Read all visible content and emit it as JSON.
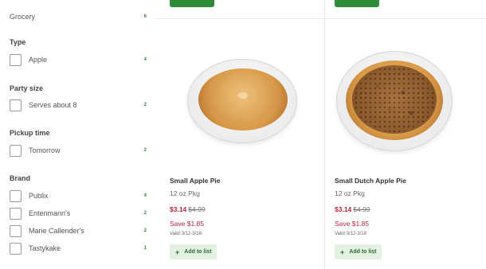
{
  "sidebar": {
    "category": {
      "label": "Grocery",
      "count": "6"
    },
    "sections": [
      {
        "title": "Type",
        "items": [
          {
            "label": "Apple",
            "count": "4"
          }
        ]
      },
      {
        "title": "Party size",
        "items": [
          {
            "label": "Serves about 8",
            "count": "2"
          }
        ]
      },
      {
        "title": "Pickup time",
        "items": [
          {
            "label": "Tomorrow",
            "count": "2"
          }
        ]
      },
      {
        "title": "Brand",
        "items": [
          {
            "label": "Publix",
            "count": "4"
          },
          {
            "label": "Entenmann's",
            "count": "2"
          },
          {
            "label": "Marie Callender's",
            "count": "2"
          },
          {
            "label": "Tastykake",
            "count": "1"
          }
        ]
      }
    ]
  },
  "products": [
    {
      "name": "Small Apple Pie",
      "size": "12 oz Pkg",
      "price": "$3.14",
      "old_price": "$4.99",
      "save": "Save $1.85",
      "valid": "Valid 3/12-3/18",
      "add_label": "Add to list",
      "add_icon": "+"
    },
    {
      "name": "Small Dutch Apple Pie",
      "size": "12 oz Pkg",
      "price": "$3.14",
      "old_price": "$4.99",
      "save": "Save $1.85",
      "valid": "Valid 3/12-3/18",
      "add_label": "Add to list",
      "add_icon": "+"
    }
  ],
  "colors": {
    "accent": "#2e8b3a",
    "sale": "#c0263d",
    "add_bg": "#e3f1e3"
  }
}
